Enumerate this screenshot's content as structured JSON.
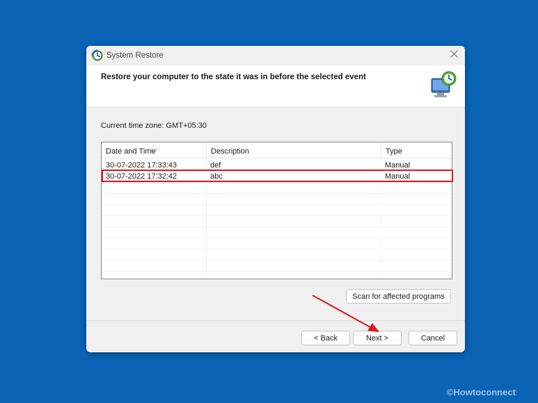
{
  "window": {
    "title": "System Restore",
    "close_glyph": "✕",
    "app_icon": "system-restore-icon"
  },
  "header": {
    "text": "Restore your computer to the state it was in before the selected event",
    "icon": "restore-monitor-icon"
  },
  "timezone_text": "Current time zone: GMT+05:30",
  "table": {
    "columns": [
      "Date and Time",
      "Description",
      "Type"
    ],
    "rows": [
      [
        "30-07-2022 17:33:43",
        "def",
        "Manual"
      ],
      [
        "30-07-2022 17:32:42",
        "abc",
        "Manual"
      ]
    ],
    "highlighted_row": 1
  },
  "buttons": {
    "scan": "Scan for affected programs",
    "back": "< Back",
    "next": "Next >",
    "cancel": "Cancel"
  },
  "annotation": {
    "highlight_color": "#e4121b",
    "arrow_color": "#e4121b"
  },
  "watermark": "©Howtoconnect",
  "colors": {
    "desktop": "#0b63b6",
    "dialog": "#f0f0f0"
  }
}
